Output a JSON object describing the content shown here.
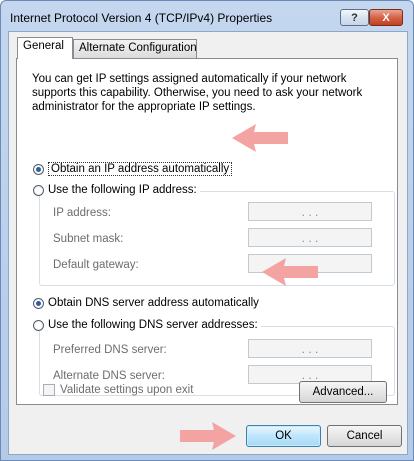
{
  "window": {
    "title": "Internet Protocol Version 4 (TCP/IPv4) Properties",
    "help_symbol": "?",
    "close_symbol": "X"
  },
  "tabs": [
    {
      "label": "General",
      "active": true
    },
    {
      "label": "Alternate Configuration",
      "active": false
    }
  ],
  "intro_text": "You can get IP settings assigned automatically if your network supports this capability. Otherwise, you need to ask your network administrator for the appropriate IP settings.",
  "ip": {
    "auto_label": "Obtain an IP address automatically",
    "manual_label": "Use the following IP address:",
    "selected": "auto",
    "fields": [
      {
        "label": "IP address:",
        "value": ". . ."
      },
      {
        "label": "Subnet mask:",
        "value": ". . ."
      },
      {
        "label": "Default gateway:",
        "value": ". . ."
      }
    ]
  },
  "dns": {
    "auto_label": "Obtain DNS server address automatically",
    "manual_label": "Use the following DNS server addresses:",
    "selected": "auto",
    "fields": [
      {
        "label": "Preferred DNS server:",
        "value": ". . ."
      },
      {
        "label": "Alternate DNS server:",
        "value": ". . ."
      }
    ]
  },
  "validate_label": "Validate settings upon exit",
  "buttons": {
    "advanced": "Advanced...",
    "ok": "OK",
    "cancel": "Cancel"
  },
  "annotation_arrow_color": "#f4a3a3",
  "icons": {
    "help": "help-icon",
    "close": "close-icon",
    "arrow": "pointer-arrow-icon"
  }
}
